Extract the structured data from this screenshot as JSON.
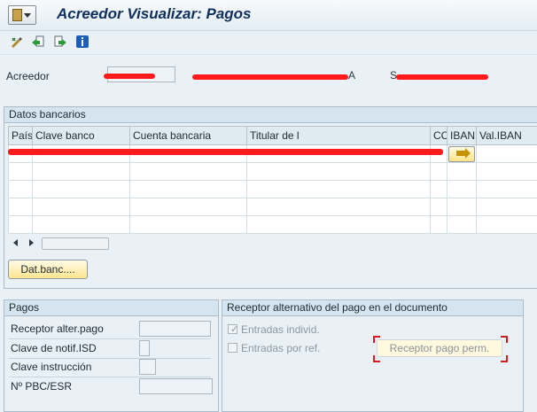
{
  "window": {
    "title": "Acreedor Visualizar: Pagos"
  },
  "toolbar": {
    "buttons": [
      {
        "name": "edit-icon"
      },
      {
        "name": "previous-screen-icon"
      },
      {
        "name": "next-screen-icon"
      },
      {
        "name": "info-icon"
      }
    ]
  },
  "vendor": {
    "label": "Acreedor",
    "field2_suffix": "A",
    "field3_prefix": "S",
    "redaction_color": "#ff1b1b"
  },
  "bank_data": {
    "title": "Datos bancarios",
    "columns": [
      "País",
      "Clave banco",
      "Cuenta bancaria",
      "Titular de l",
      "CC",
      "IBAN",
      "Val.IBAN"
    ],
    "button_label": "Dat.banc...."
  },
  "payments": {
    "title": "Pagos",
    "fields": [
      {
        "label": "Receptor alter.pago",
        "value": ""
      },
      {
        "label": "Clave de notif.ISD",
        "value": ""
      },
      {
        "label": "Clave instrucción",
        "value": ""
      },
      {
        "label": "Nº PBC/ESR",
        "value": ""
      }
    ]
  },
  "alt_payee": {
    "title": "Receptor alternativo del pago en el documento",
    "individual_label": "Entradas individ.",
    "individual_checked": true,
    "reference_label": "Entradas por ref.",
    "reference_checked": false,
    "button_label": "Receptor pago perm."
  },
  "colors": {
    "title_text": "#0f2f5e",
    "accent_button": "#ffe58f",
    "panel_background": "#eaf1f6"
  }
}
